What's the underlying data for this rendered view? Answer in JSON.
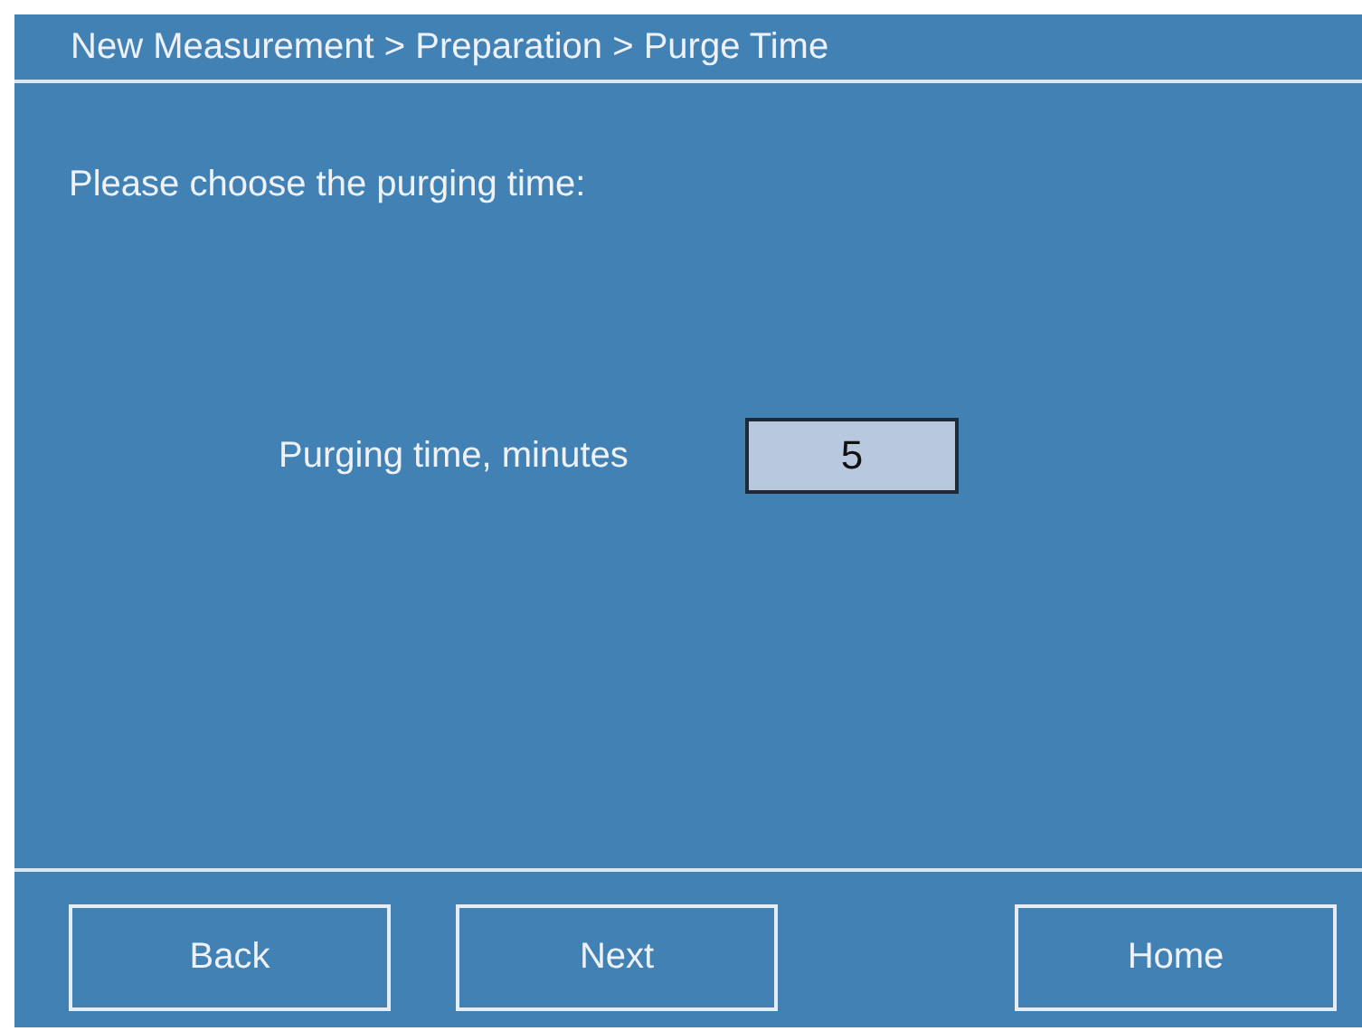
{
  "breadcrumb": "New Measurement > Preparation > Purge Time",
  "prompt": "Please choose the purging time:",
  "field": {
    "label": "Purging time, minutes",
    "value": "5"
  },
  "footer": {
    "left_buttons": [
      "Back",
      "Next"
    ],
    "right_buttons": [
      "Home"
    ]
  }
}
